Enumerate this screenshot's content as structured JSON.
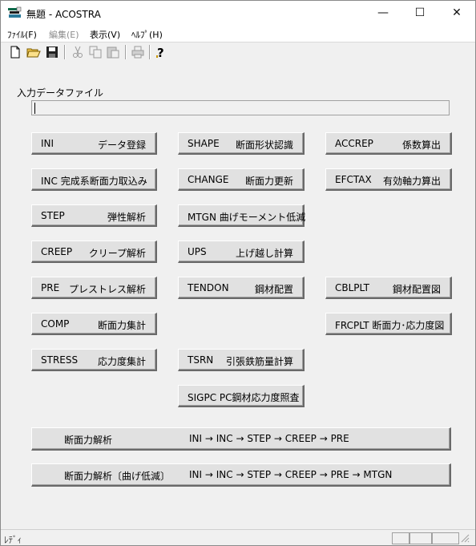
{
  "window": {
    "title": "無題 - ACOSTRA",
    "minimize": "—",
    "maximize": "☐",
    "close": "✕"
  },
  "menu": [
    {
      "label": "ﾌｧｲﾙ(F)",
      "enabled": true
    },
    {
      "label": "編集(E)",
      "enabled": false
    },
    {
      "label": "表示(V)",
      "enabled": true
    },
    {
      "label": "ﾍﾙﾌﾟ(H)",
      "enabled": true
    }
  ],
  "toolbar": {
    "icons": [
      "new-file-icon",
      "open-folder-icon",
      "save-icon",
      "cut-icon",
      "copy-icon",
      "paste-icon",
      "print-icon",
      "help-icon"
    ]
  },
  "form": {
    "input_label": "入力データファイル",
    "input_value": ""
  },
  "buttons": {
    "ini": {
      "code": "INI",
      "desc": "データ登録"
    },
    "shape": {
      "code": "SHAPE",
      "desc": "断面形状認識"
    },
    "accrep": {
      "code": "ACCREP",
      "desc": "係数算出"
    },
    "inc": {
      "code": "INC 完成系断面力取込み",
      "desc": ""
    },
    "change": {
      "code": "CHANGE",
      "desc": "断面力更新"
    },
    "efctax": {
      "code": "EFCTAX",
      "desc": "有効軸力算出"
    },
    "step": {
      "code": "STEP",
      "desc": "弾性解析"
    },
    "mtgn": {
      "code": "MTGN 曲げモーメント低減",
      "desc": ""
    },
    "creep": {
      "code": "CREEP",
      "desc": "クリープ解析"
    },
    "ups": {
      "code": "UPS",
      "desc": "上げ越し計算"
    },
    "pre": {
      "code": "PRE",
      "desc": "プレストレス解析"
    },
    "tendon": {
      "code": "TENDON",
      "desc": "鋼材配置"
    },
    "cblplt": {
      "code": "CBLPLT",
      "desc": "鋼材配置図"
    },
    "comp": {
      "code": "COMP",
      "desc": "断面力集計"
    },
    "frcplt": {
      "code": "FRCPLT 断面力･応力度図",
      "desc": ""
    },
    "stress": {
      "code": "STRESS",
      "desc": "応力度集計"
    },
    "tsrn": {
      "code": "TSRN",
      "desc": "引張鉄筋量計算"
    },
    "sigpc": {
      "code": "SIGPC PC鋼材応力度照査",
      "desc": ""
    },
    "run1": {
      "label": "断面力解析",
      "flow": "INI → INC → STEP → CREEP → PRE"
    },
    "run2": {
      "label": "断面力解析〔曲げ低減〕",
      "flow": "INI → INC → STEP → CREEP → PRE → MTGN"
    }
  },
  "status": {
    "text": "ﾚﾃﾞｨ"
  }
}
